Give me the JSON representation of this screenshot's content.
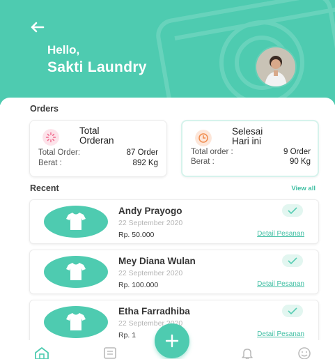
{
  "header": {
    "greeting": "Hello,",
    "shop_name": "Sakti Laundry",
    "accent_color": "#4ecbb0",
    "back_icon": "arrow-left-icon",
    "avatar_icon": "profile-avatar"
  },
  "orders_section": {
    "title": "Orders"
  },
  "stats": {
    "total": {
      "title_line1": "Total",
      "title_line2": "Orderan",
      "icon": "sparkle-icon",
      "row1_label": "Total Order:",
      "row1_value": "87 Order",
      "row2_label": "Berat :",
      "row2_value": "892 Kg"
    },
    "done": {
      "title_line1": "Selesai",
      "title_line2": "Hari ini",
      "icon": "clock-icon",
      "row1_label": "Total order :",
      "row1_value": "9 Order",
      "row2_label": "Berat :",
      "row2_value": "90 Kg"
    }
  },
  "recent_section": {
    "title": "Recent",
    "view_all": "View all"
  },
  "recent_orders": [
    {
      "name": "Andy Prayogo",
      "date": "22 September 2020",
      "price": "Rp. 50.000",
      "detail": "Detail Pesanan"
    },
    {
      "name": "Mey Diana Wulan",
      "date": "22 September 2020",
      "price": "Rp. 100.000",
      "detail": "Detail Pesanan"
    },
    {
      "name": "Etha Farradhiba",
      "date": "22 September 2020",
      "price": "Rp. 1",
      "detail": "Detail Pesanan"
    }
  ],
  "bottom_nav": {
    "items": [
      "home-icon",
      "orders-list-icon",
      "add-icon",
      "bell-icon",
      "smiley-icon"
    ]
  }
}
